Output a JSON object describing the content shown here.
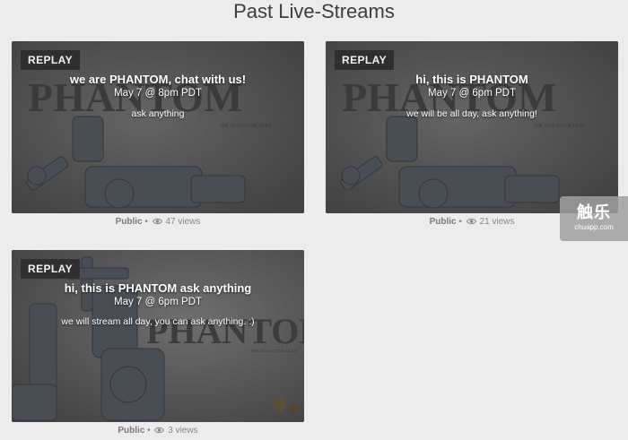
{
  "page": {
    "title": "Past Live-Streams"
  },
  "cards": [
    {
      "badge": "REPLAY",
      "title": "we are PHANTOM, chat with us!",
      "date": "May 7 @ 8pm PDT",
      "description": "ask anything",
      "visibility": "Public",
      "views": "47 views",
      "logo_text": "PHANTOM",
      "logo_sub": "THE SOULSTONE FILES"
    },
    {
      "badge": "REPLAY",
      "title": "hi, this is PHANTOM",
      "date": "May 7 @ 6pm PDT",
      "description": "we will be all day, ask anything!",
      "visibility": "Public",
      "views": "21 views",
      "logo_text": "PHANTOM",
      "logo_sub": "THE SOULSTONE FILES"
    },
    {
      "badge": "REPLAY",
      "title": "hi, this is PHANTOM ask anything",
      "date": "May 7 @ 6pm PDT",
      "description": "we will stream all day, you can ask anything. :)",
      "visibility": "Public",
      "views": "3 views",
      "logo_text": "PHANTOM",
      "logo_sub": "THE SOULSTONE FILES"
    }
  ],
  "watermark": {
    "main": "触乐",
    "sub": "chuapp.com"
  },
  "icons": {
    "views": "eye-icon"
  },
  "colors": {
    "background": "#ececec",
    "badge": "#2f2f2f",
    "meta_text": "#888888"
  }
}
